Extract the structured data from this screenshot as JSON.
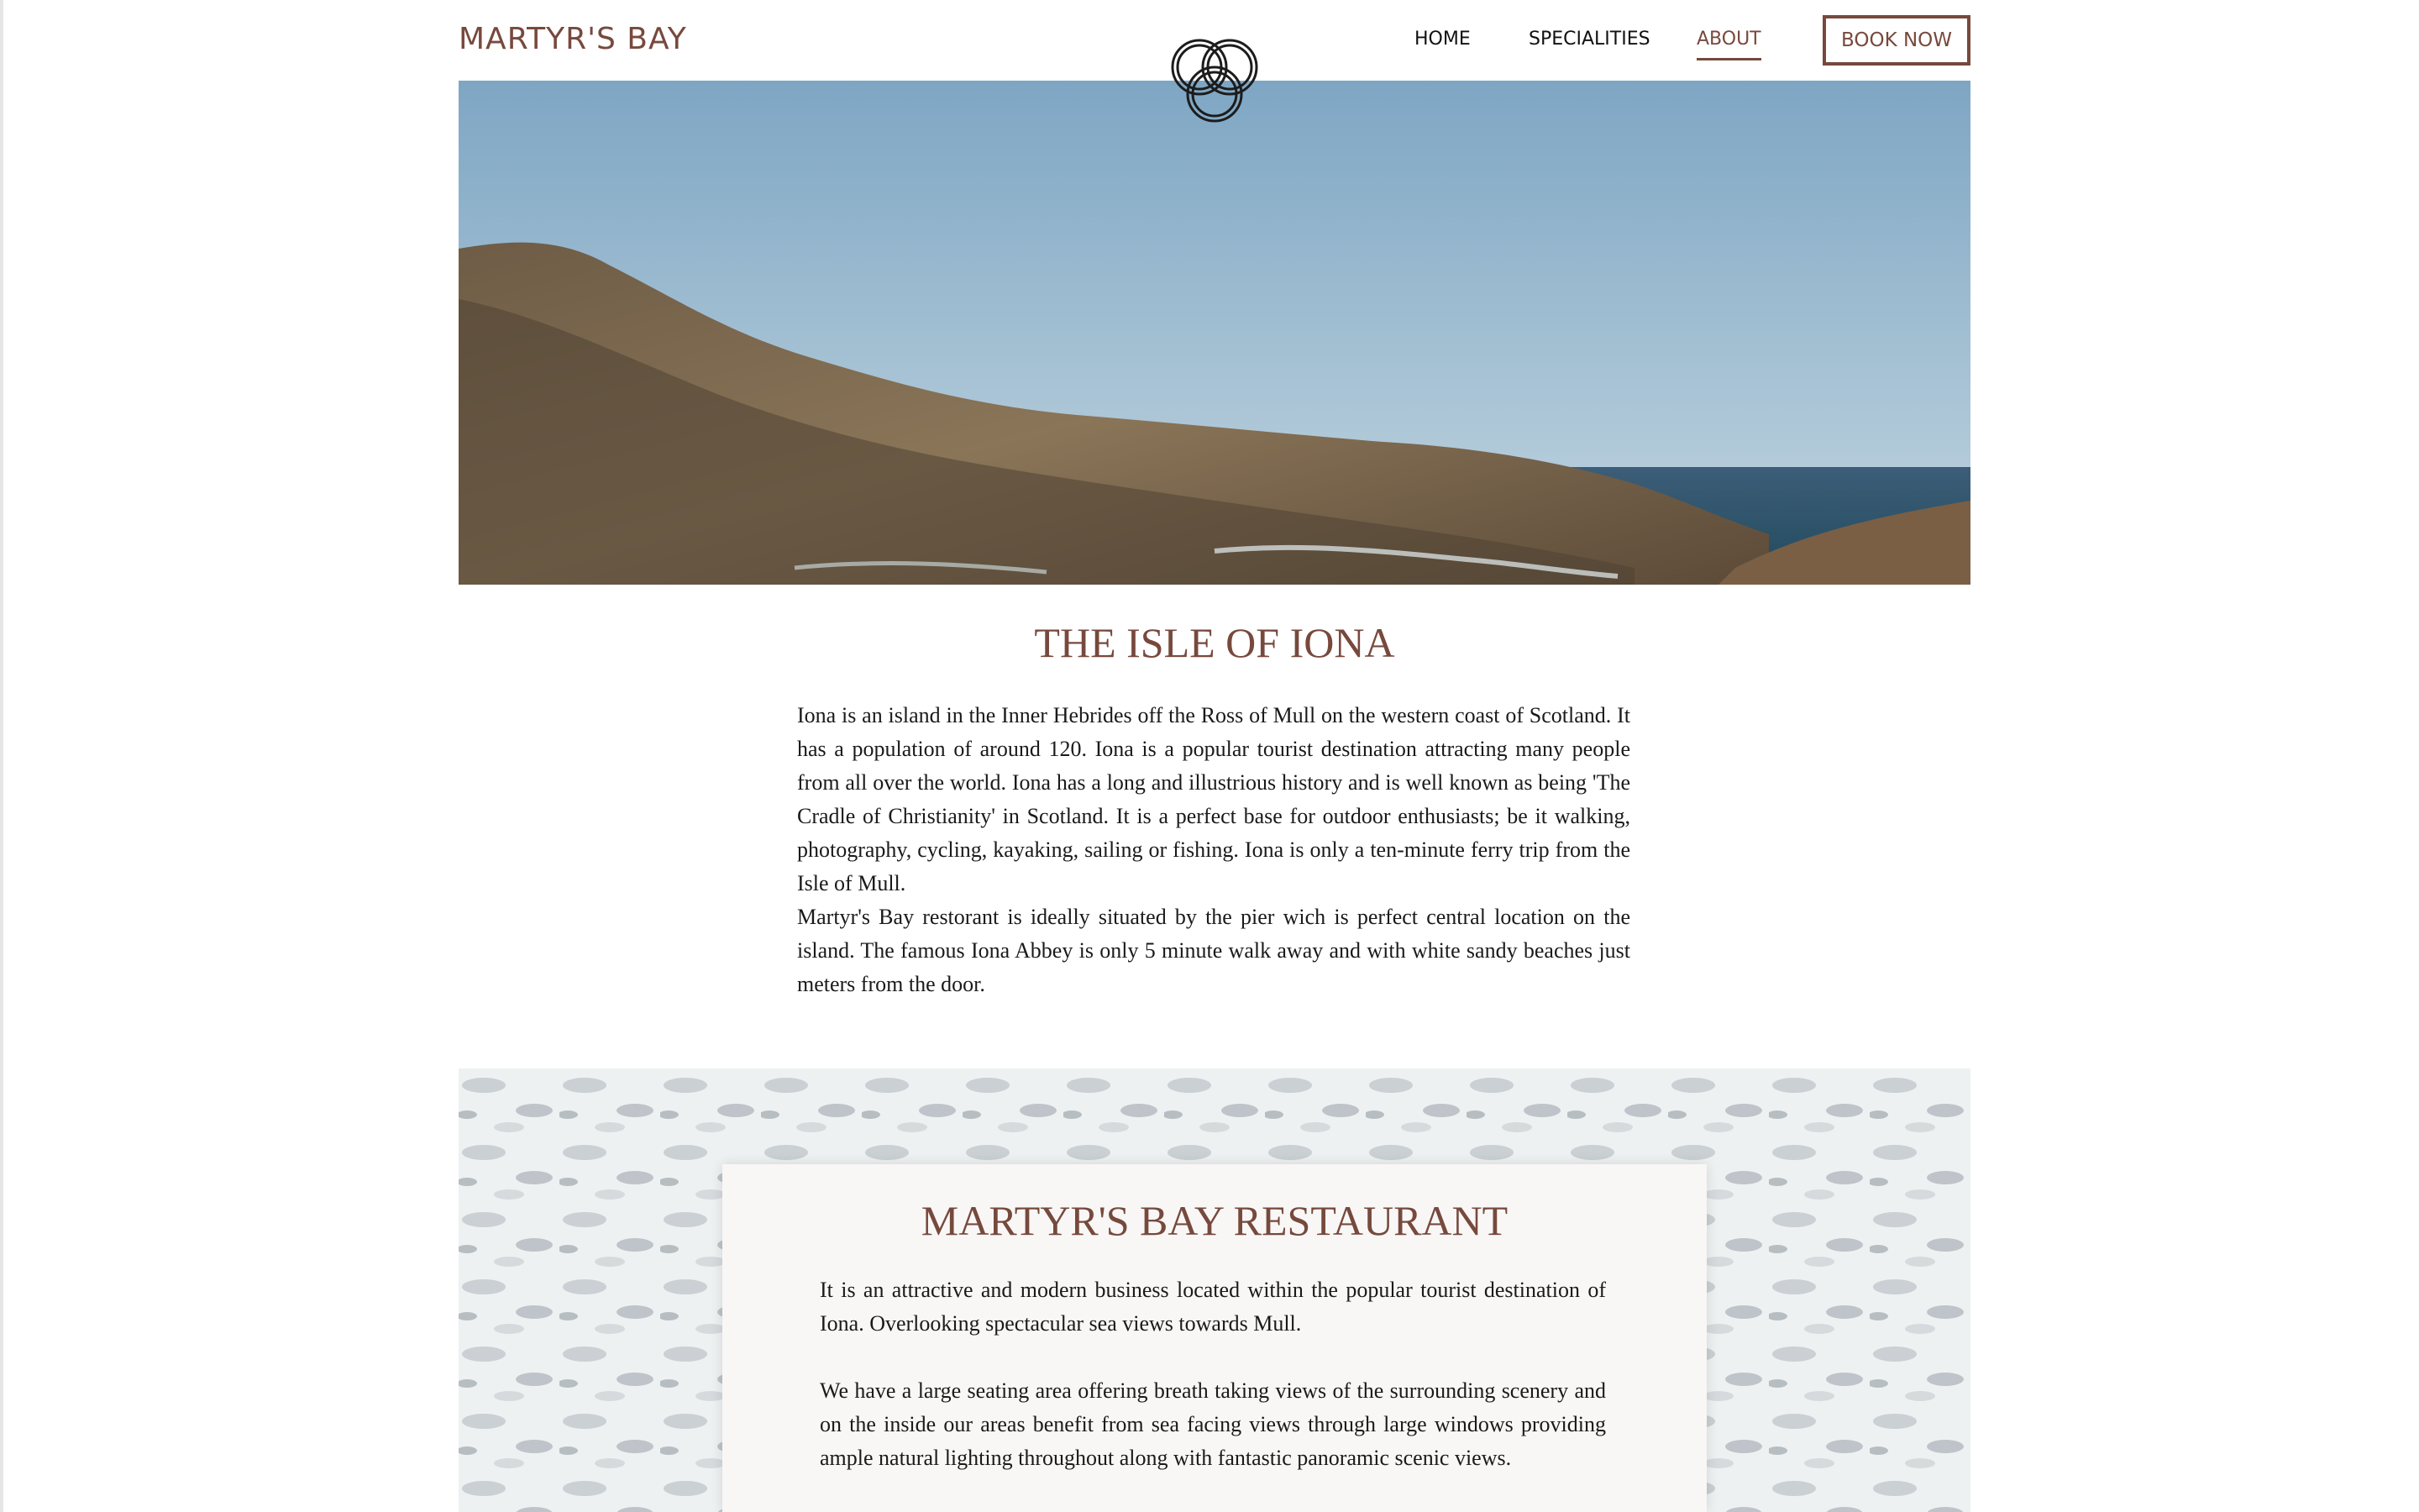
{
  "header": {
    "brand": "MARTYR'S BAY",
    "nav": [
      {
        "label": "HOME",
        "active": false
      },
      {
        "label": "SPECIALITIES",
        "active": false
      },
      {
        "label": "ABOUT",
        "active": true
      }
    ],
    "book_label": "BOOK NOW"
  },
  "colors": {
    "accent": "#77493d",
    "text": "#1a1a1a",
    "card_bg": "#f8f7f6"
  },
  "icons": {
    "logo": "interlocking-rings-logo-icon"
  },
  "hero": {
    "image": "rocky-coastline-photo"
  },
  "iona": {
    "title": "THE ISLE OF IONA",
    "p1": "Iona is an island in the Inner Hebrides off the Ross of Mull on the western coast of Scotland. It has a population of around 120. Iona is a popular tourist destination attracting many people from all over the world. Iona has a long and illustrious history and is well known as being 'The Cradle of Christianity' in Scotland. It is a perfect base for outdoor enthusiasts; be it walking, photography, cycling, kayaking, sailing or fishing. Iona is only a ten-minute ferry trip from the Isle of Mull.",
    "p2": "Martyr's Bay restorant is ideally situated by the pier wich is perfect central location on the island. The famous Iona Abbey is only 5 minute walk away and with white sandy beaches just meters from the door."
  },
  "restaurant": {
    "background": "sea-foam-photo",
    "title": "MARTYR'S BAY RESTAURANT",
    "p1": "It is an attractive and modern business located within the popular tourist destination of Iona. Overlooking spectacular sea views towards Mull.",
    "p2": "We have a large seating area offering breath taking views of the surrounding scenery and on the inside our areas benefit from sea facing views through large windows providing ample natural lighting throughout along with fantastic panoramic scenic views."
  }
}
